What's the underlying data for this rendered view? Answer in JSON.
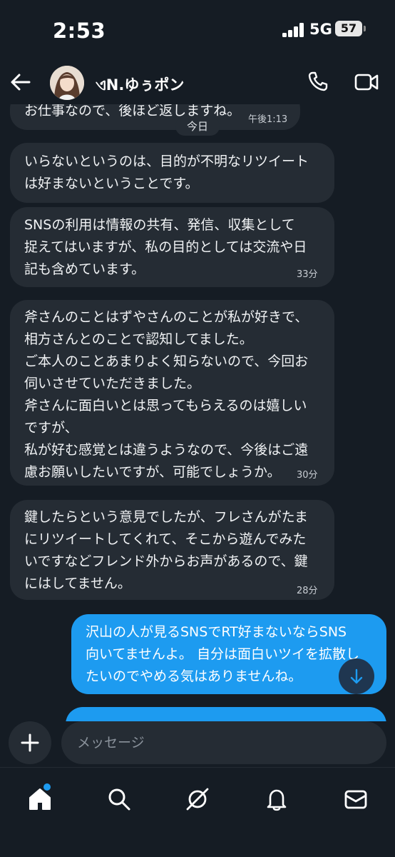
{
  "status_bar": {
    "time": "2:53",
    "network": "5G",
    "battery": "57"
  },
  "header": {
    "contact_name": "ଏN.ゆぅポン"
  },
  "date_divider": "今日",
  "messages": [
    {
      "direction": "in",
      "text": "お仕事なので、後ほど返しますね。",
      "time": "午後1:13"
    },
    {
      "direction": "in",
      "text": "いらないというのは、目的が不明なリツイート\nは好まないということです。",
      "time": ""
    },
    {
      "direction": "in",
      "text": "SNSの利用は情報の共有、発信、収集として\n捉えてはいますが、私の目的としては交流や日\n記も含めています。",
      "time": "33分"
    },
    {
      "direction": "in",
      "text": "斧さんのことはずやさんのことが私が好きで、\n相方さんとのことで認知してました。\nご本人のことあまりよく知らないので、今回お\n伺いさせていただきました。\n斧さんに面白いとは思ってもらえるのは嬉しい\nですが、\n私が好む感覚とは違うようなので、今後はご遠\n慮お願いしたいですが、可能でしょうか。",
      "time": "30分"
    },
    {
      "direction": "in",
      "text": "鍵したらという意見でしたが、フレさんがたま\nにリツイートしてくれて、そこから遊んでみた\nいですなどフレンド外からお声があるので、鍵\nにはしてません。",
      "time": "28分"
    },
    {
      "direction": "out",
      "text": "沢山の人が見るSNSでRT好まないならSNS\n向いてませんよ。 自分は面白いツイを拡散し\nたいのでやめる気はありませんね。",
      "time": ""
    }
  ],
  "composer": {
    "placeholder": "メッセージ"
  },
  "nav": {
    "items": [
      "home-icon",
      "search-icon",
      "grok-icon",
      "notifications-icon",
      "messages-icon"
    ]
  },
  "colors": {
    "accent": "#1d9bf0",
    "bubble_in": "#252c34",
    "background": "#151c24"
  }
}
